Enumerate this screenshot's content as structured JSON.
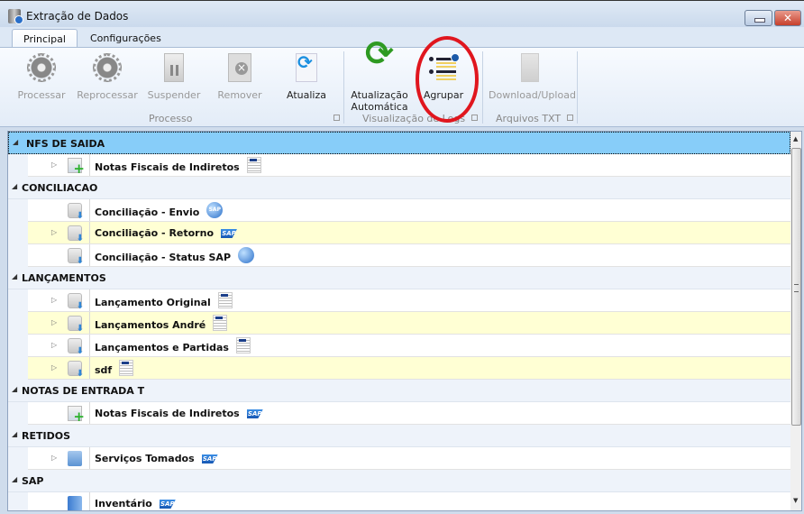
{
  "window": {
    "title": "Extração de Dados",
    "minimize": "–",
    "close": "✕"
  },
  "tabs": [
    {
      "label": "Principal",
      "active": true
    },
    {
      "label": "Configurações",
      "active": false
    }
  ],
  "ribbon": {
    "buttons": [
      {
        "label": "Processar",
        "icon": "gear-icon",
        "enabled": false
      },
      {
        "label": "Reprocessar",
        "icon": "gears-icon",
        "enabled": false
      },
      {
        "label": "Suspender",
        "icon": "pause-icon",
        "enabled": false
      },
      {
        "label": "Remover",
        "icon": "remove-icon",
        "enabled": false
      },
      {
        "label": "Atualiza",
        "icon": "refresh-icon",
        "enabled": true
      },
      {
        "label": "Atualização",
        "label2": "Automática",
        "icon": "auto-refresh-icon",
        "enabled": true
      },
      {
        "label": "Agrupar",
        "icon": "group-icon",
        "enabled": true,
        "annotated": true
      },
      {
        "label": "Download/Upload",
        "icon": "download-upload-icon",
        "enabled": false
      }
    ],
    "groups": [
      "Processo",
      "Visualização de Logs",
      "Arquivos TXT"
    ],
    "annotation_color": "#e0161e"
  },
  "tree": {
    "groups": [
      {
        "label": "NFS DE SAIDA",
        "selected": true,
        "items": [
          {
            "label": "Notas Fiscais de Indiretos",
            "icon": "document-add-icon",
            "badge": "doc",
            "expandable": true,
            "highlight": false
          }
        ]
      },
      {
        "label": "CONCILIACAO",
        "items": [
          {
            "label": "Conciliação - Envio",
            "icon": "database-download-icon",
            "badge": "sap-globe",
            "expandable": false,
            "highlight": false
          },
          {
            "label": "Conciliação - Retorno",
            "icon": "database-download-icon",
            "badge": "sap",
            "expandable": true,
            "highlight": true
          },
          {
            "label": "Conciliação - Status SAP",
            "icon": "database-download-icon",
            "badge": "globe",
            "expandable": false,
            "highlight": false
          }
        ]
      },
      {
        "label": "LANÇAMENTOS",
        "items": [
          {
            "label": "Lançamento Original",
            "icon": "database-download-icon",
            "badge": "doc",
            "expandable": true,
            "highlight": false
          },
          {
            "label": "Lançamentos André",
            "icon": "database-download-icon",
            "badge": "doc",
            "expandable": true,
            "highlight": true
          },
          {
            "label": "Lançamentos e Partidas",
            "icon": "database-download-icon",
            "badge": "doc",
            "expandable": true,
            "highlight": false
          },
          {
            "label": "sdf",
            "icon": "database-download-icon",
            "badge": "doc",
            "expandable": true,
            "highlight": true
          }
        ]
      },
      {
        "label": "NOTAS DE ENTRADA T",
        "items": [
          {
            "label": "Notas Fiscais de Indiretos",
            "icon": "document-add-icon",
            "badge": "sap",
            "expandable": false,
            "highlight": false
          }
        ]
      },
      {
        "label": "RETIDOS",
        "items": [
          {
            "label": "Serviços Tomados",
            "icon": "folder-tool-icon",
            "badge": "sap",
            "expandable": true,
            "highlight": false
          }
        ]
      },
      {
        "label": "SAP",
        "items": [
          {
            "label": "Inventário",
            "icon": "book-icon",
            "badge": "sap",
            "expandable": false,
            "highlight": false
          }
        ]
      }
    ],
    "highlight_color": "#ffffd4",
    "selected_color": "#87cdf9",
    "badge_sap_text": "SAP"
  }
}
